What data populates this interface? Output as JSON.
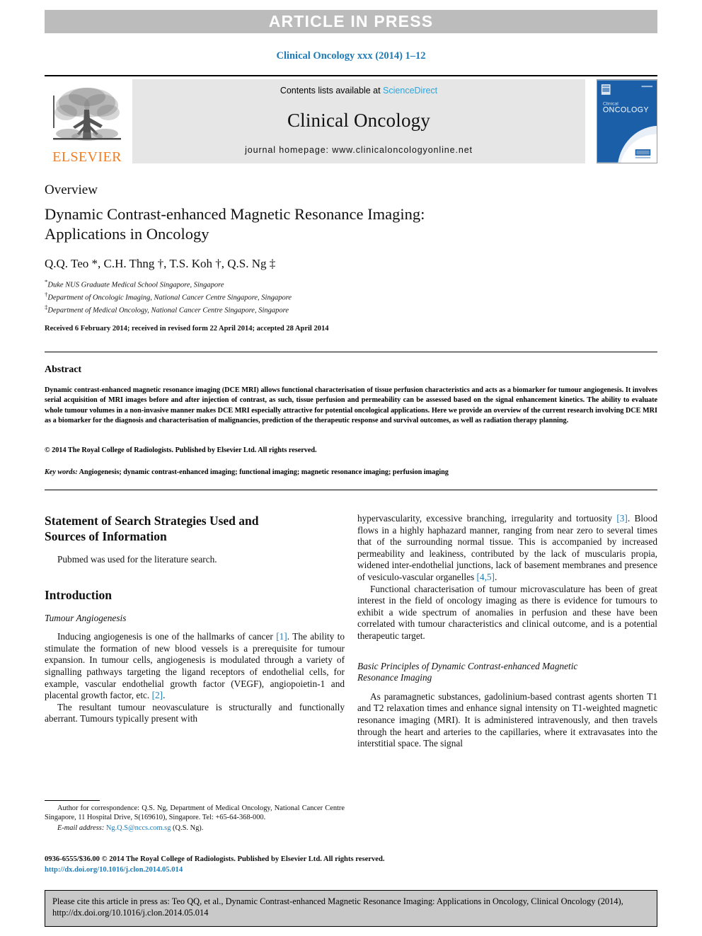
{
  "banner": {
    "text": "ARTICLE IN PRESS"
  },
  "journal_ref": "Clinical Oncology xxx (2014) 1–12",
  "masthead": {
    "contents_prefix": "Contents lists available at ",
    "sciencedirect": "ScienceDirect",
    "journal_name": "Clinical Oncology",
    "homepage": "journal homepage: www.clinicaloncologyonline.net",
    "publisher_wordmark": "ELSEVIER",
    "cover_title_small": "Clinical",
    "cover_title_large": "ONCOLOGY"
  },
  "article": {
    "type_label": "Overview",
    "title_line1": "Dynamic Contrast-enhanced Magnetic Resonance Imaging:",
    "title_line2": "Applications in Oncology",
    "authors": "Q.Q. Teo *, C.H. Thng †, T.S. Koh †, Q.S. Ng ‡",
    "affiliations": [
      {
        "marker": "*",
        "text": "Duke NUS Graduate Medical School Singapore, Singapore"
      },
      {
        "marker": "†",
        "text": "Department of Oncologic Imaging, National Cancer Centre Singapore, Singapore"
      },
      {
        "marker": "‡",
        "text": "Department of Medical Oncology, National Cancer Centre Singapore, Singapore"
      }
    ],
    "received": "Received 6 February 2014; received in revised form 22 April 2014; accepted 28 April 2014"
  },
  "abstract": {
    "heading": "Abstract",
    "body": "Dynamic contrast-enhanced magnetic resonance imaging (DCE MRI) allows functional characterisation of tissue perfusion characteristics and acts as a biomarker for tumour angiogenesis. It involves serial acquisition of MRI images before and after injection of contrast, as such, tissue perfusion and permeability can be assessed based on the signal enhancement kinetics. The ability to evaluate whole tumour volumes in a non-invasive manner makes DCE MRI especially attractive for potential oncological applications. Here we provide an overview of the current research involving DCE MRI as a biomarker for the diagnosis and characterisation of malignancies, prediction of the therapeutic response and survival outcomes, as well as radiation therapy planning.",
    "copyright": "© 2014 The Royal College of Radiologists. Published by Elsevier Ltd. All rights reserved.",
    "keywords_label": "Key words:",
    "keywords_value": " Angiogenesis; dynamic contrast-enhanced imaging; functional imaging; magnetic resonance imaging; perfusion imaging"
  },
  "body": {
    "search_heading_line1": "Statement of Search Strategies Used and",
    "search_heading_line2": "Sources of Information",
    "search_para": "Pubmed was used for the literature search.",
    "intro_heading": "Introduction",
    "angio_subheading": "Tumour Angiogenesis",
    "left_para_1a": "Inducing angiogenesis is one of the hallmarks of cancer ",
    "left_para_1_ref1": "[1]",
    "left_para_1b": ". The ability to stimulate the formation of new blood vessels is a prerequisite for tumour expansion. In tumour cells, angiogenesis is modulated through a variety of signalling pathways targeting the ligand receptors of endothelial cells, for example, vascular endothelial growth factor (VEGF), angiopoietin-1 and placental growth factor, etc. ",
    "left_para_1_ref2": "[2]",
    "left_para_1c": ".",
    "left_para_2": "The resultant tumour neovasculature is structurally and functionally aberrant. Tumours typically present with",
    "right_para_1a": "hypervascularity, excessive branching, irregularity and tortuosity ",
    "right_para_1_ref3": "[3]",
    "right_para_1b": ". Blood flows in a highly haphazard manner, ranging from near zero to several times that of the surrounding normal tissue. This is accompanied by increased permeability and leakiness, contributed by the lack of muscularis propia, widened inter-endothelial junctions, lack of basement membranes and presence of vesiculo-vascular organelles ",
    "right_para_1_ref45": "[4,5]",
    "right_para_1c": ".",
    "right_para_2": "Functional characterisation of tumour microvasculature has been of great interest in the field of oncology imaging as there is evidence for tumours to exhibit a wide spectrum of anomalies in perfusion and these have been correlated with tumour characteristics and clinical outcome, and is a potential therapeutic target.",
    "basic_subheading_line1": "Basic Principles of Dynamic Contrast-enhanced Magnetic",
    "basic_subheading_line2": "Resonance Imaging",
    "right_para_3": "As paramagnetic substances, gadolinium-based contrast agents shorten T1 and T2 relaxation times and enhance signal intensity on T1-weighted magnetic resonance imaging (MRI). It is administered intravenously, and then travels through the heart and arteries to the capillaries, where it extravasates into the interstitial space. The signal"
  },
  "footnote": {
    "correspondence": "Author for correspondence: Q.S. Ng, Department of Medical Oncology, National Cancer Centre Singapore, 11 Hospital Drive, S(169610), Singapore. Tel: +65-64-368-000.",
    "email_label": "E-mail address:",
    "email": "Ng.Q.S@nccs.com.sg",
    "email_suffix": " (Q.S. Ng)."
  },
  "imprint": {
    "issn_line": "0936-6555/$36.00 © 2014 The Royal College of Radiologists. Published by Elsevier Ltd. All rights reserved.",
    "doi": "http://dx.doi.org/10.1016/j.clon.2014.05.014"
  },
  "citation_footer": {
    "text": "Please cite this article in press as: Teo QQ, et al., Dynamic Contrast-enhanced Magnetic Resonance Imaging: Applications in Oncology, Clinical Oncology (2014), http://dx.doi.org/10.1016/j.clon.2014.05.014"
  },
  "colors": {
    "link_blue": "#1f7bb6",
    "sciencedirect_blue": "#2ba6de",
    "elsevier_orange": "#f47c20",
    "banner_gray": "#bcbcbc",
    "masthead_gray": "#e6e6e6",
    "footer_gray": "#c9c9c9",
    "cover_blue": "#1b5fa8"
  }
}
